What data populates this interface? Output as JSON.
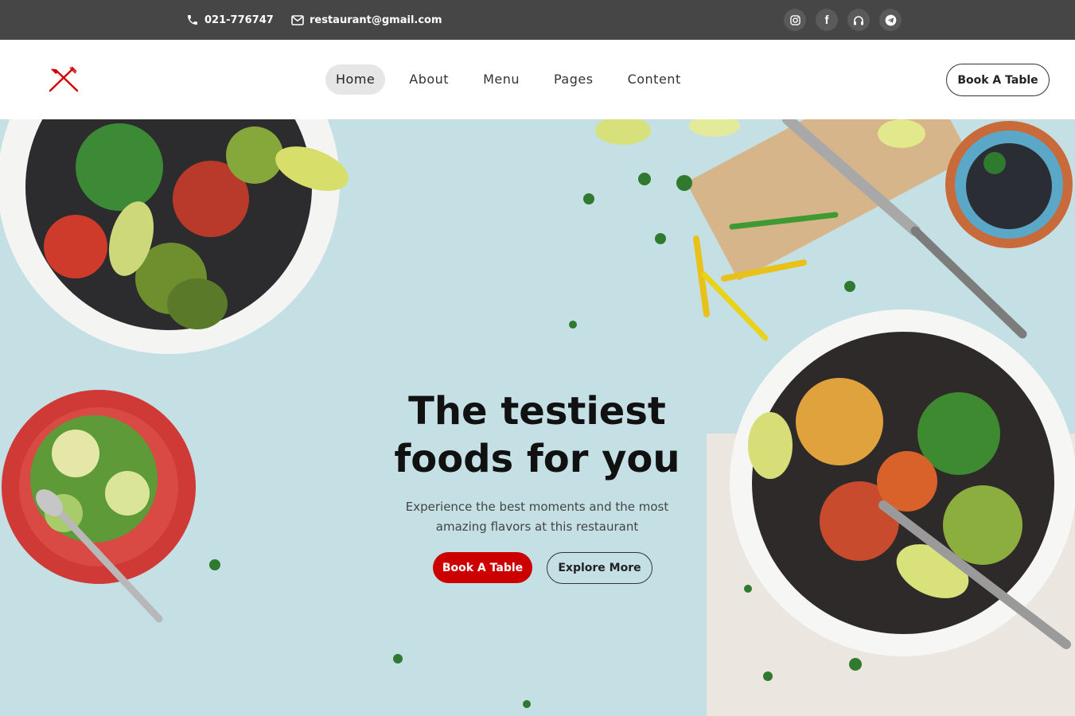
{
  "topbar": {
    "phone": "021-776747",
    "email": "restaurant@gmail.com",
    "socials": [
      "instagram-icon",
      "facebook-icon",
      "headphones-icon",
      "telegram-icon"
    ],
    "facebook_glyph": "f"
  },
  "nav": {
    "logo": "fork-knife-icon",
    "items": [
      {
        "label": "Home",
        "active": true
      },
      {
        "label": "About"
      },
      {
        "label": "Menu"
      },
      {
        "label": "Pages"
      },
      {
        "label": "Content"
      }
    ],
    "cta": "Book A Table"
  },
  "hero": {
    "title_line1": "The testiest",
    "title_line2": "foods for you",
    "subtitle_line1": "Experience the best moments and the most",
    "subtitle_line2": "amazing flavors at this restaurant",
    "primary_button": "Book A Table",
    "secondary_button": "Explore More"
  },
  "colors": {
    "topbar": "#464646",
    "accent": "#cc0000",
    "hero_background": "#c4e0e5",
    "nav_active": "#e6e6e6"
  }
}
